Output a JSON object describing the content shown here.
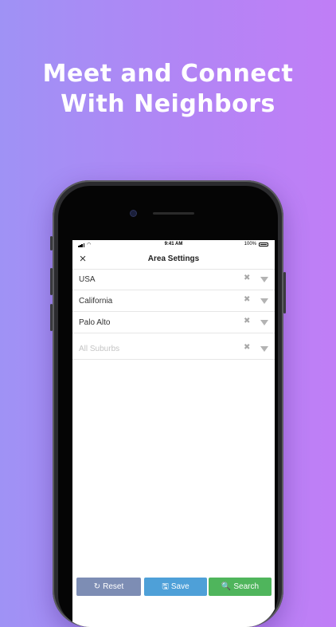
{
  "headline": {
    "line1": "Meet and Connect",
    "line2": "With Neighbors"
  },
  "status_bar": {
    "time": "9:41 AM",
    "battery": "100%"
  },
  "nav": {
    "close_icon": "×",
    "title": "Area Settings"
  },
  "fields": [
    {
      "value": "USA",
      "placeholder": false
    },
    {
      "value": "California",
      "placeholder": false
    },
    {
      "value": "Palo Alto",
      "placeholder": false
    },
    {
      "value": "All Suburbs",
      "placeholder": true
    }
  ],
  "clear_symbol": "✖",
  "actions": {
    "reset": {
      "icon": "↻",
      "label": "Reset",
      "color": "#7d8db4"
    },
    "save": {
      "icon": "🖫",
      "label": "Save",
      "color": "#4ea0d8"
    },
    "search": {
      "icon": "🔍",
      "label": "Search",
      "color": "#4fb55c"
    }
  }
}
